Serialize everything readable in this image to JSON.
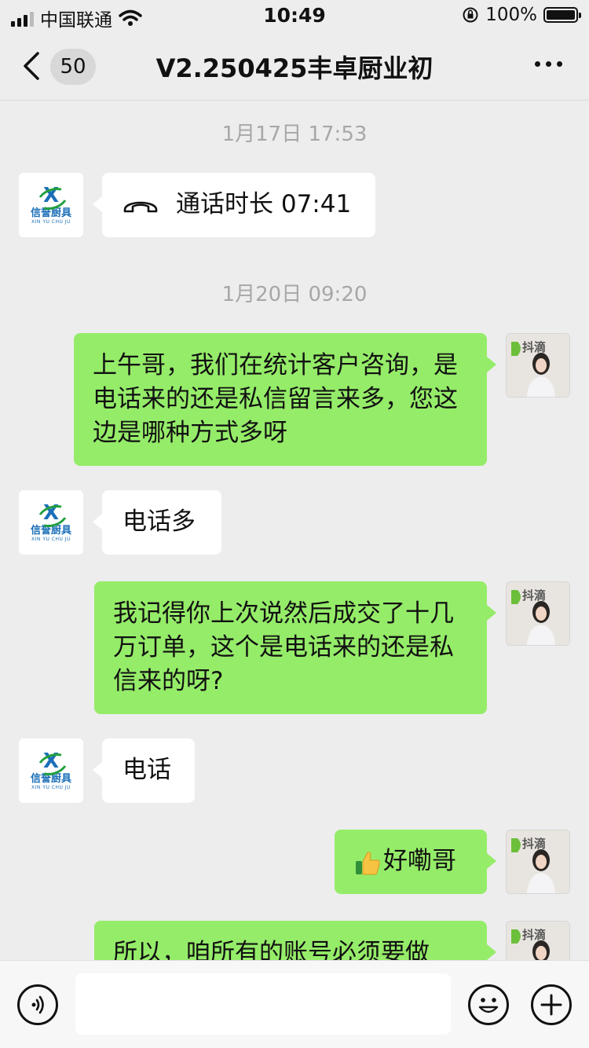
{
  "status_bar": {
    "carrier": "中国联通",
    "time": "10:49",
    "battery_percent": "100%",
    "icons": [
      "signal-icon",
      "wifi-icon",
      "orientation-lock-icon",
      "battery-icon"
    ]
  },
  "nav": {
    "unread_count": "50",
    "title": "V2.250425丰卓厨业初"
  },
  "contact_avatar": {
    "logo_letter": "X",
    "logo_name": "信誉厨具",
    "logo_pinyin": "XIN YU CHU JU"
  },
  "my_avatar": {
    "logo_text": "抖滴"
  },
  "messages": {
    "ts1": "1月17日 17:53",
    "call": "通话时长 07:41",
    "ts2": "1月20日 09:20",
    "m1": "上午哥，我们在统计客户咨询，是电话来的还是私信留言来多，您这边是哪种方式多呀",
    "m2": "电话多",
    "m3": "我记得你上次说然后成交了十几万订单，这个是电话来的还是私信来的呀?",
    "m4": "电话",
    "m5": "好嘞哥",
    "m6": "所以，咱所有的账号必须要做"
  },
  "input": {
    "value": ""
  },
  "colors": {
    "background": "#ededed",
    "my_bubble": "#95ec69",
    "their_bubble": "#ffffff",
    "timestamp_text": "#a7a7a7"
  }
}
